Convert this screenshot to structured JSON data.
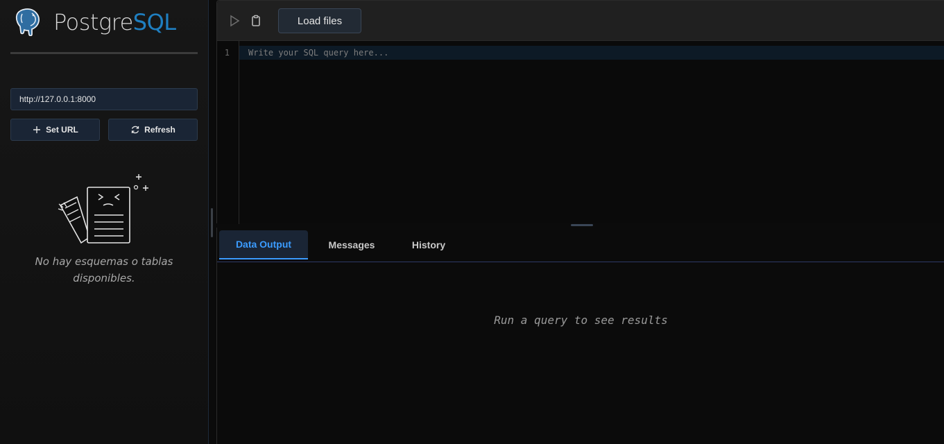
{
  "sidebar": {
    "logo": {
      "text_a": "Postgre",
      "text_b": "SQL",
      "icon": "elephant-icon"
    },
    "url_input": {
      "value": "http://127.0.0.1:8000"
    },
    "buttons": {
      "set_url": "Set URL",
      "refresh": "Refresh"
    },
    "empty_state": {
      "text": "No hay esquemas o tablas disponibles.",
      "icon": "empty-document-icon"
    }
  },
  "toolbar": {
    "run_icon": "play-icon",
    "clear_icon": "clipboard-icon",
    "load_files": "Load files"
  },
  "editor": {
    "line_number": "1",
    "placeholder": "Write your SQL query here..."
  },
  "results": {
    "tabs": [
      {
        "label": "Data Output",
        "active": true
      },
      {
        "label": "Messages",
        "active": false
      },
      {
        "label": "History",
        "active": false
      }
    ],
    "empty_message": "Run a query to see results"
  },
  "colors": {
    "accent": "#3b9cff",
    "logo_blue": "#1f7fc1",
    "panel": "#1a2535"
  }
}
